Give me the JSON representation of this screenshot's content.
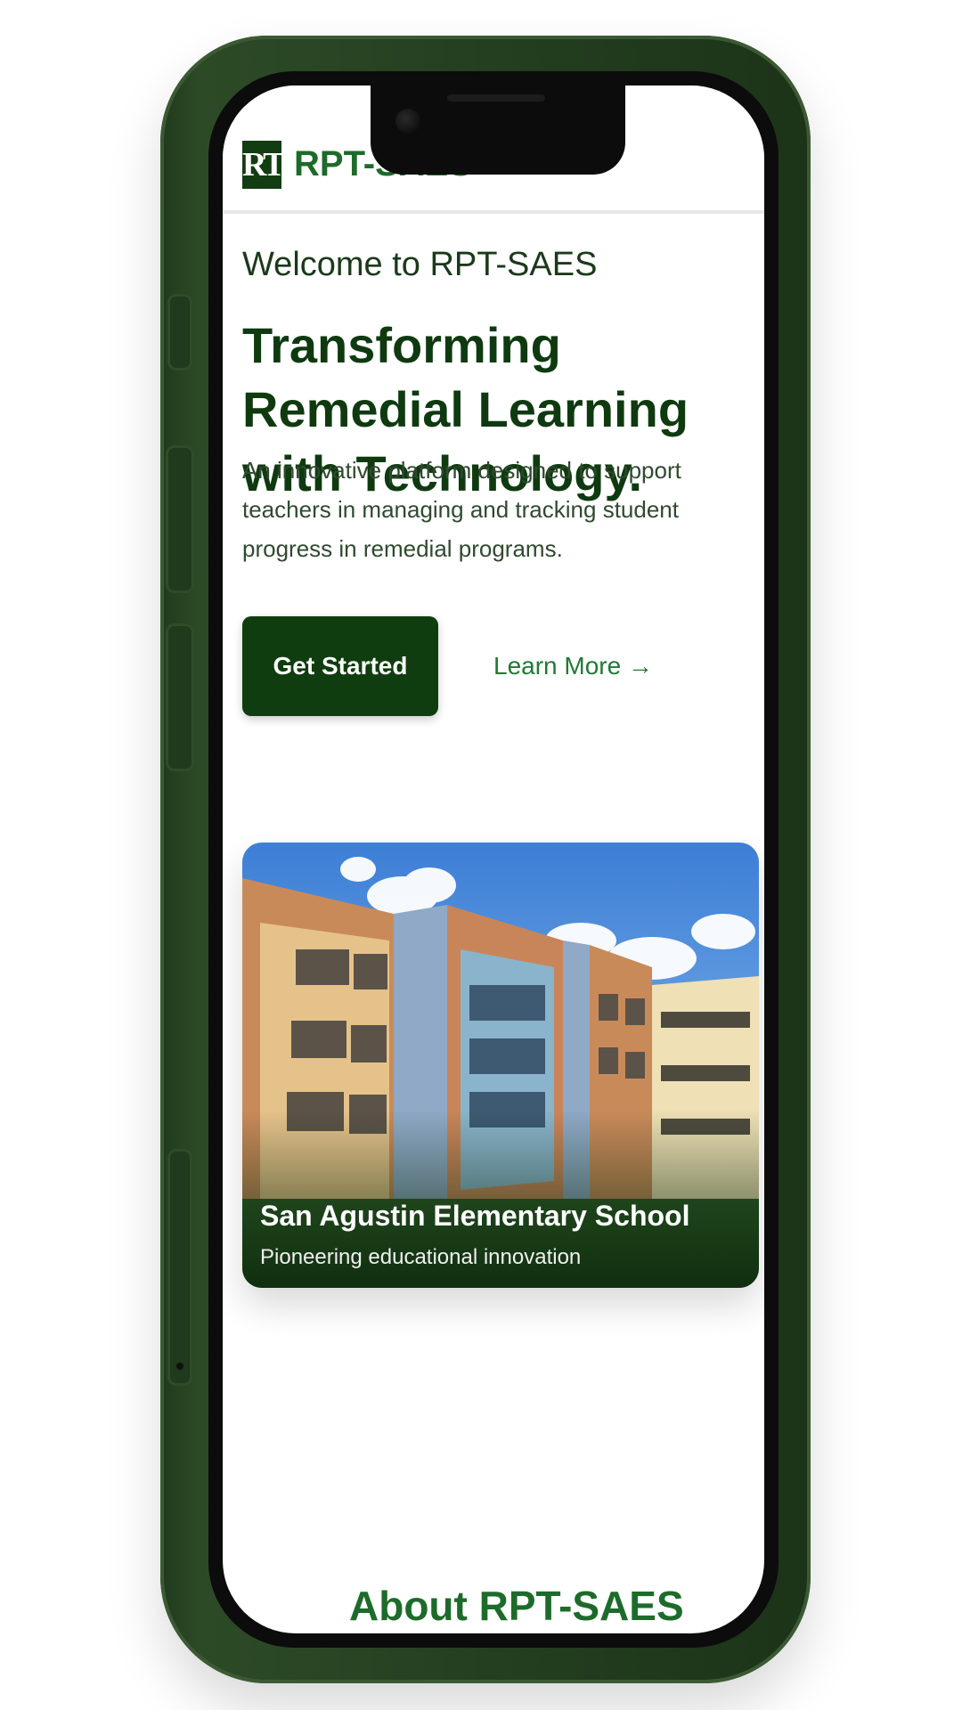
{
  "header": {
    "logo_mark": "RT",
    "brand_name": "RPT-SAES"
  },
  "hero": {
    "welcome": "Welcome to RPT-SAES",
    "headline": "Transforming Remedial Learning with Technology.",
    "description": "An innovative platform designed to support teachers in managing and tracking student progress in remedial programs.",
    "primary_button": "Get Started",
    "secondary_link": "Learn More →"
  },
  "school_card": {
    "title": "San Agustin Elementary School",
    "subtitle": "Pioneering educational innovation"
  },
  "next_section": {
    "heading_partial": "About RPT-SAES"
  },
  "colors": {
    "brand_green": "#0f3d0f",
    "accent_green": "#1f7a33",
    "phone_frame": "#243f20"
  }
}
